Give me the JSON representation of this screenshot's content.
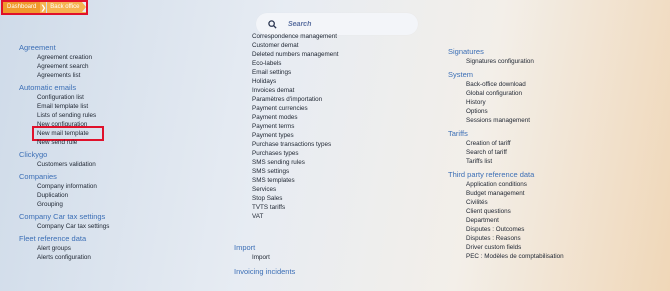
{
  "breadcrumb": [
    "Dashboard",
    "Back office"
  ],
  "search": {
    "placeholder": "Search"
  },
  "col1": [
    {
      "category": "Agreement",
      "items": [
        "Agreement creation",
        "Agreement search",
        "Agreements list"
      ]
    },
    {
      "category": "Automatic emails",
      "items": [
        "Configuration list",
        "Email template list",
        "Lists of sending rules",
        "New configuration",
        "New mail template",
        "New send rule"
      ]
    },
    {
      "category": "Clickygo",
      "items": [
        "Customers validation"
      ]
    },
    {
      "category": "Companies",
      "items": [
        "Company information",
        "Duplication",
        "Grouping"
      ]
    },
    {
      "category": "Company Car tax settings",
      "items": [
        "Company Car tax settings"
      ]
    },
    {
      "category": "Fleet reference data",
      "items": [
        "Alert groups",
        "Alerts configuration"
      ]
    }
  ],
  "col2_items": [
    "Correspondence management",
    "Customer demat",
    "Deleted numbers management",
    "Eco-labels",
    "Email settings",
    "Holidays",
    "Invoices demat",
    "Paramètres d'importation",
    "Payment currencies",
    "Payment modes",
    "Payment terms",
    "Payment types",
    "Purchase transactions types",
    "Purchases types",
    "SMS sending rules",
    "SMS settings",
    "SMS templates",
    "Services",
    "Stop Sales",
    "TVTS tariffs",
    "VAT"
  ],
  "col2_import": {
    "category": "Import",
    "items": [
      "Import"
    ]
  },
  "col2_invoicing": {
    "category": "Invoicing incidents"
  },
  "col3": [
    {
      "category": "Signatures",
      "items": [
        "Signatures configuration"
      ]
    },
    {
      "category": "System",
      "items": [
        "Back-office download",
        "Global configuration",
        "History",
        "Options",
        "Sessions management"
      ]
    },
    {
      "category": "Tariffs",
      "items": [
        "Creation of tariff",
        "Search of tariff",
        "Tariffs list"
      ]
    },
    {
      "category": "Third party reference data",
      "items": [
        "Application conditions",
        "Budget management",
        "Civilités",
        "Client questions",
        "Department",
        "Disputes : Outcomes",
        "Disputes : Reasons",
        "Driver custom fields",
        "PEC : Modèles de comptabilisation"
      ]
    }
  ],
  "colors": {
    "accent": "#3c6fb6",
    "breadcrumb": "#f09a2c",
    "highlight": "#e0112b"
  }
}
